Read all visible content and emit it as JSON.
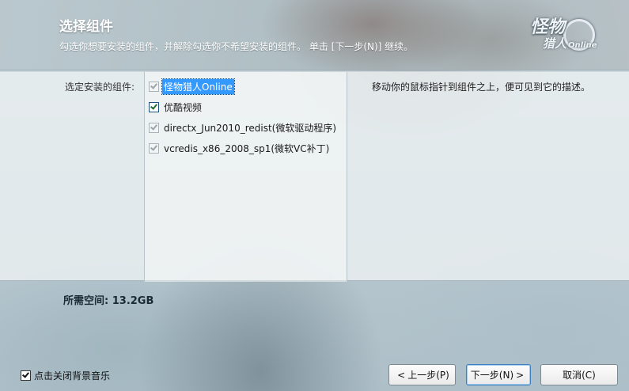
{
  "header": {
    "title": "选择组件",
    "subtitle": "勾选你想要安装的组件，并解除勾选你不希望安装的组件。 单击 [下一步(N)] 继续。",
    "logo": {
      "line1": "怪物",
      "line2": "猎人",
      "mark": "Online"
    }
  },
  "components": {
    "label": "选定安装的组件:",
    "items": [
      {
        "label": "怪物猎人Online",
        "checked": true,
        "enabled": false,
        "selected": true
      },
      {
        "label": "优酷视频",
        "checked": true,
        "enabled": true,
        "selected": false
      },
      {
        "label": "directx_Jun2010_redist(微软驱动程序)",
        "checked": true,
        "enabled": false,
        "selected": false
      },
      {
        "label": "vcredis_x86_2008_sp1(微软VC补丁)",
        "checked": true,
        "enabled": false,
        "selected": false
      }
    ],
    "description": "移动你的鼠标指针到组件之上，便可见到它的描述。"
  },
  "space_required": "所需空间: 13.2GB",
  "footer": {
    "music_toggle": {
      "label": "点击关闭背景音乐",
      "checked": true
    },
    "prev_label": "上一步(P)",
    "next_label": "下一步(N)",
    "cancel_label": "取消(C)"
  },
  "colors": {
    "selection": "#3399ff",
    "title_text": "#ffffff"
  }
}
